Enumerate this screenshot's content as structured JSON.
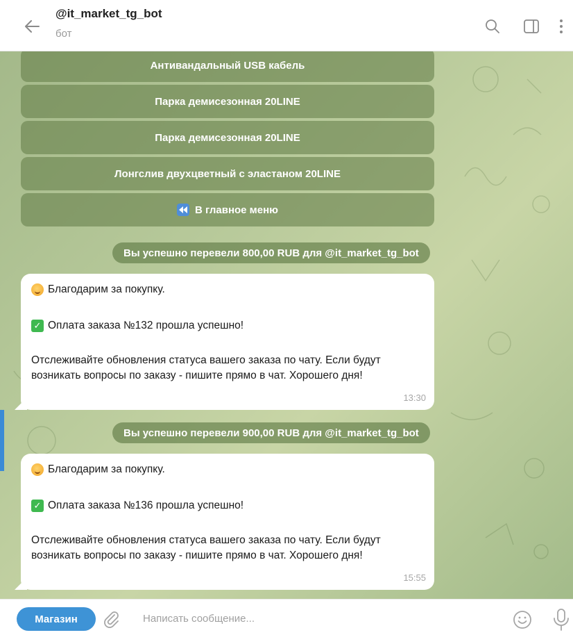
{
  "header": {
    "title": "@it_market_tg_bot",
    "subtitle": "бот",
    "icons": [
      "back-arrow-icon",
      "search-icon",
      "sidebar-toggle-icon",
      "more-icon"
    ]
  },
  "keyboard": {
    "buttons": [
      "Антивандальный USB кабель",
      "Парка демисезонная 20LINE",
      "Парка демисезонная 20LINE",
      "Лонгслив двухцветный с эластаном 20LINE",
      "В главное меню"
    ]
  },
  "messages": [
    {
      "service": "Вы успешно перевели 800,00 RUB для @it_market_tg_bot",
      "thanks": "Благодарим за покупку.",
      "payment": "Оплата заказа №132 прошла успешно!",
      "track": "Отслеживайте обновления статуса вашего заказа по чату. Если будут возникать вопросы по заказу - пишите прямо в чат. Хорошего дня!",
      "time": "13:30"
    },
    {
      "service": "Вы успешно перевели 900,00 RUB для @it_market_tg_bot",
      "thanks": "Благодарим за покупку.",
      "payment": "Оплата заказа №136 прошла успешно!",
      "track": "Отслеживайте обновления статуса вашего заказа по чату. Если будут возникать вопросы по заказу - пишите прямо в чат. Хорошего дня!",
      "time": "15:55"
    }
  ],
  "input": {
    "shop_label": "Магазин",
    "placeholder": "Написать сообщение..."
  },
  "colors": {
    "accent": "#3e93d6",
    "chat_bg": "#b7c99a",
    "button_bg": "#607a46"
  }
}
